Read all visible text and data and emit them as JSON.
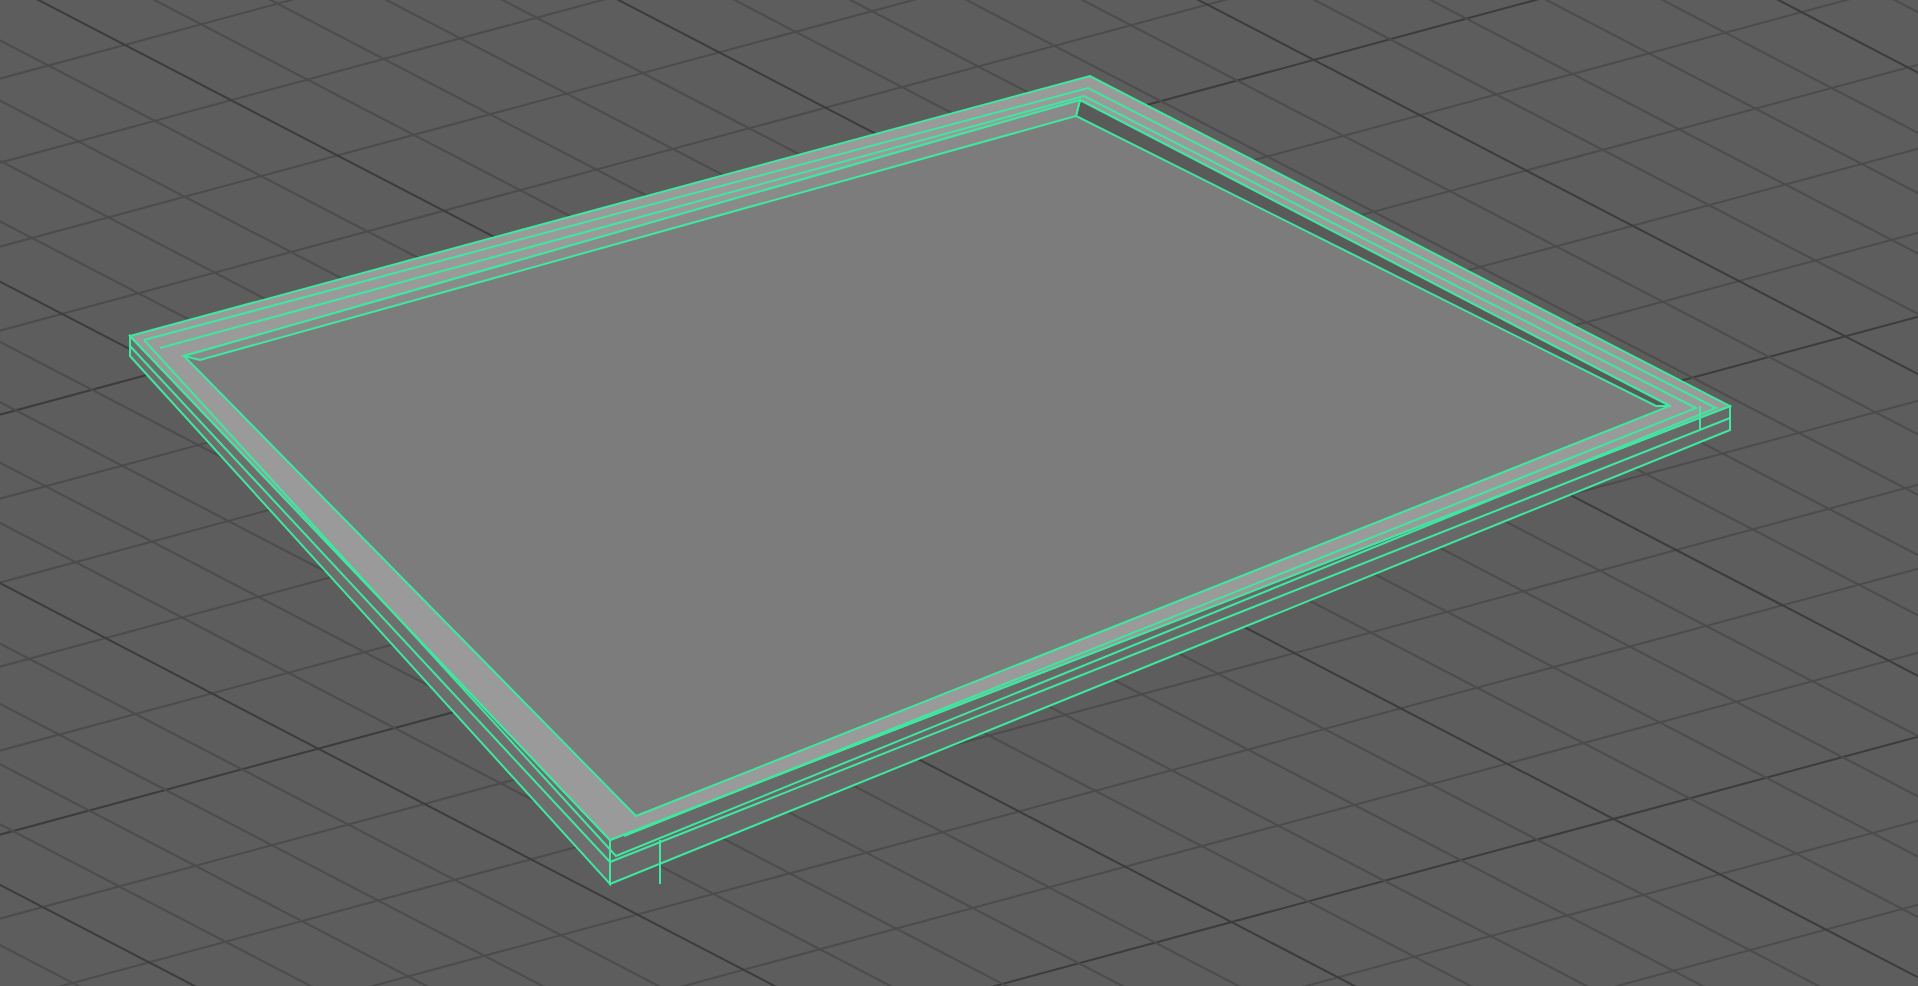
{
  "viewport": {
    "object": {
      "selected": true
    }
  }
}
